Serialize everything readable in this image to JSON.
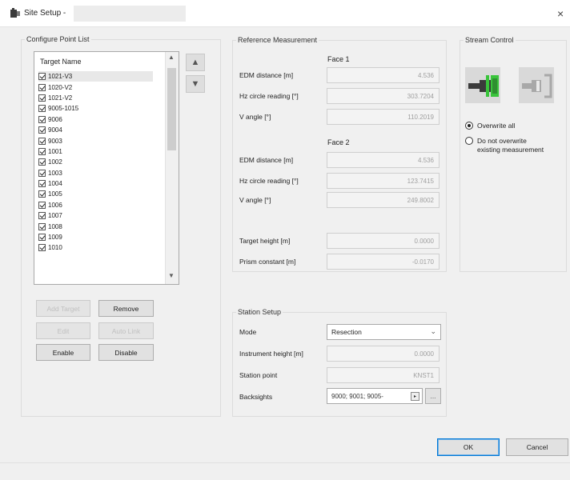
{
  "window": {
    "title": "Site Setup -",
    "close_glyph": "×"
  },
  "point_list": {
    "group_title": "Configure Point List",
    "header": "Target Name",
    "items": [
      {
        "label": "1021-V3",
        "checked": true,
        "selected": true
      },
      {
        "label": "1020-V2",
        "checked": true
      },
      {
        "label": "1021-V2",
        "checked": true
      },
      {
        "label": "9005-1015",
        "checked": true
      },
      {
        "label": "9006",
        "checked": true
      },
      {
        "label": "9004",
        "checked": true
      },
      {
        "label": "9003",
        "checked": true
      },
      {
        "label": "1001",
        "checked": true
      },
      {
        "label": "1002",
        "checked": true
      },
      {
        "label": "1003",
        "checked": true
      },
      {
        "label": "1004",
        "checked": true
      },
      {
        "label": "1005",
        "checked": true
      },
      {
        "label": "1006",
        "checked": true
      },
      {
        "label": "1007",
        "checked": true
      },
      {
        "label": "1008",
        "checked": true
      },
      {
        "label": "1009",
        "checked": true
      },
      {
        "label": "1010",
        "checked": true
      }
    ],
    "buttons": {
      "add": "Add Target",
      "remove": "Remove",
      "edit": "Edit",
      "auto_link": "Auto Link",
      "enable": "Enable",
      "disable": "Disable"
    }
  },
  "reference": {
    "group_title": "Reference Measurement",
    "face1": {
      "title": "Face 1",
      "edm_label": "EDM distance [m]",
      "edm_value": "4.536",
      "hz_label": "Hz circle reading [°]",
      "hz_value": "303.7204",
      "v_label": "V angle [°]",
      "v_value": "110.2019"
    },
    "face2": {
      "title": "Face 2",
      "edm_label": "EDM distance [m]",
      "edm_value": "4.536",
      "hz_label": "Hz circle reading [°]",
      "hz_value": "123.7415",
      "v_label": "V angle [°]",
      "v_value": "249.8002"
    },
    "target_height_label": "Target height [m]",
    "target_height_value": "0.0000",
    "prism_label": "Prism constant [m]",
    "prism_value": "-0.0170"
  },
  "stream": {
    "group_title": "Stream Control",
    "overwrite_all": "Overwrite all",
    "no_overwrite_line1": "Do not overwrite",
    "no_overwrite_line2": "existing measurement",
    "selected": "overwrite_all",
    "active_color": "#39c43b"
  },
  "station": {
    "group_title": "Station Setup",
    "mode_label": "Mode",
    "mode_value": "Resection",
    "inst_height_label": "Instrument height [m]",
    "inst_height_value": "0.0000",
    "station_point_label": "Station point",
    "station_point_value": "KNST1",
    "backsights_label": "Backsights",
    "backsights_value": "9000; 9001; 9005-",
    "more_label": "..."
  },
  "footer": {
    "ok": "OK",
    "cancel": "Cancel"
  }
}
